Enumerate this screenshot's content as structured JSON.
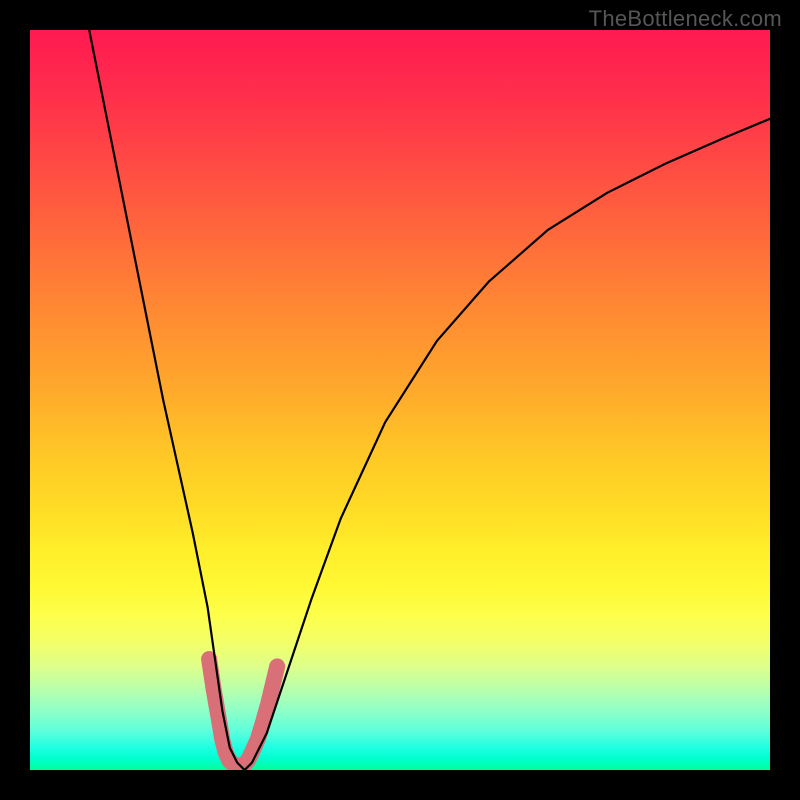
{
  "watermark": "TheBottleneck.com",
  "chart_data": {
    "type": "line",
    "title": "",
    "xlabel": "",
    "ylabel": "",
    "xlim": [
      0,
      100
    ],
    "ylim": [
      0,
      100
    ],
    "series": [
      {
        "name": "main-curve",
        "color": "#000000",
        "x": [
          8,
          10,
          12,
          14,
          16,
          18,
          20,
          22,
          24,
          25,
          26,
          27,
          28,
          29,
          30,
          32,
          34,
          38,
          42,
          48,
          55,
          62,
          70,
          78,
          86,
          94,
          100
        ],
        "y": [
          100,
          90,
          80,
          70,
          60,
          50,
          41,
          32,
          22,
          15,
          8,
          3,
          1,
          0,
          1,
          5,
          11,
          23,
          34,
          47,
          58,
          66,
          73,
          78,
          82,
          85.5,
          88
        ]
      },
      {
        "name": "bottom-highlight",
        "color": "#d97078",
        "x": [
          24.2,
          24.8,
          25.5,
          26,
          26.5,
          27,
          27.5,
          28,
          28.5,
          29,
          29.5,
          30,
          30.8,
          31.5,
          32.2,
          32.8,
          33.4
        ],
        "y": [
          15,
          11,
          7,
          4,
          2.2,
          1.2,
          0.8,
          0.6,
          0.6,
          0.8,
          1.4,
          2.4,
          4.2,
          6.5,
          9,
          11.5,
          14
        ]
      }
    ]
  }
}
